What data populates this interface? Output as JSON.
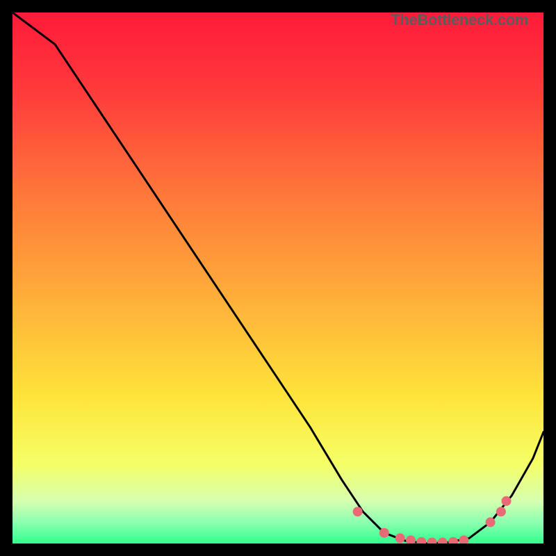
{
  "attribution": "TheBottleneck.com",
  "chart_data": {
    "type": "line",
    "title": "",
    "xlabel": "",
    "ylabel": "",
    "xlim": [
      0,
      100
    ],
    "ylim": [
      0,
      100
    ],
    "series": [
      {
        "name": "curve",
        "x": [
          0,
          8,
          16,
          24,
          32,
          40,
          48,
          56,
          62,
          66,
          70,
          74,
          78,
          82,
          86,
          90,
          94,
          98,
          100
        ],
        "y": [
          100,
          94,
          82,
          70,
          58,
          46,
          34,
          22,
          12,
          6,
          2,
          0.5,
          0,
          0.2,
          1,
          4,
          9,
          16,
          21
        ]
      }
    ],
    "markers": {
      "name": "highlight-dots",
      "x": [
        65,
        70,
        73,
        75,
        77,
        79,
        81,
        83,
        85,
        90,
        92,
        93
      ],
      "y": [
        6,
        2,
        1,
        0.6,
        0.3,
        0.2,
        0.2,
        0.3,
        0.6,
        4,
        6,
        8
      ]
    },
    "gradient_stops": [
      {
        "offset": 0.0,
        "color": "#ff1a3a"
      },
      {
        "offset": 0.15,
        "color": "#ff3b3b"
      },
      {
        "offset": 0.35,
        "color": "#ff7a3a"
      },
      {
        "offset": 0.55,
        "color": "#ffb23a"
      },
      {
        "offset": 0.72,
        "color": "#ffe33a"
      },
      {
        "offset": 0.85,
        "color": "#f5ff66"
      },
      {
        "offset": 0.92,
        "color": "#d7ffb0"
      },
      {
        "offset": 0.96,
        "color": "#8cffb0"
      },
      {
        "offset": 1.0,
        "color": "#2fff8c"
      }
    ],
    "marker_color": "#e96a75",
    "line_color": "#000000"
  }
}
